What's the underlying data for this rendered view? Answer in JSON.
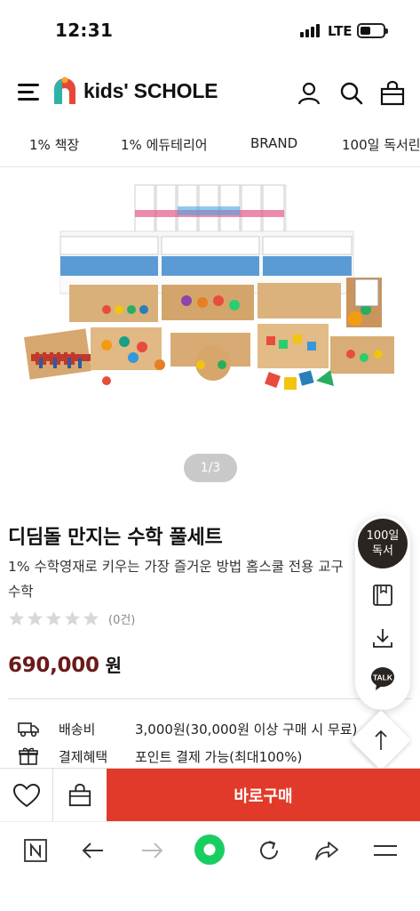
{
  "status_bar": {
    "time": "12:31",
    "network": "LTE"
  },
  "header": {
    "logo_text": "kids' SCHOLE"
  },
  "nav_tabs": [
    "1% 책장",
    "1% 에듀테리어",
    "BRAND",
    "100일 독서린"
  ],
  "hero": {
    "pager": "1/3"
  },
  "product": {
    "title": "디딤돌 만지는 수학 풀세트",
    "description": "1% 수학영재로 키우는 가장 즐거운 방법 홈스쿨 전용 교구 수학",
    "review_count": "(0건)",
    "rating": 0,
    "price": "690,000",
    "price_unit": "원"
  },
  "info": [
    {
      "label": "배송비",
      "value": "3,000원(30,000원 이상 구매 시 무료)"
    },
    {
      "label": "결제혜택",
      "value": "포인트 결제 가능(최대100%)"
    }
  ],
  "floating_menu": {
    "badge_line1": "100일",
    "badge_line2": "독서",
    "talk": "TALK"
  },
  "buy_bar": {
    "buy_label": "바로구매"
  },
  "colors": {
    "accent": "#e23a2a",
    "price": "#6b1a1a",
    "badge": "#2a2520"
  }
}
